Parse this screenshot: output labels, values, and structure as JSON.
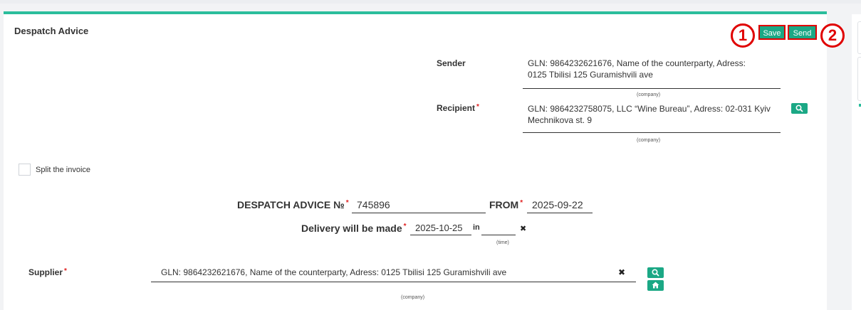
{
  "form": {
    "title": "Despatch Advice",
    "save_label": "Save",
    "send_label": "Send",
    "badge1": "1",
    "badge2": "2"
  },
  "sender": {
    "label": "Sender",
    "value_line1": "GLN: 9864232621676, Name of the counterparty, Adress:",
    "value_line2": "0125 Tbilisi 125 Guramishvili ave",
    "caption": "(company)"
  },
  "recipient": {
    "label": "Recipient",
    "required": "*",
    "value_line1": "GLN: 9864232758075, LLC “Wine Bureau”, Adress: 02-031 Kyiv",
    "value_line2": "Mechnikova st. 9",
    "caption": "(company)",
    "search_icon": "search-icon"
  },
  "split": {
    "label": "Split the invoice",
    "checked": false
  },
  "header": {
    "number_label": "DESPATCH ADVICE №",
    "number_required": "*",
    "number_value": "745896",
    "from_label": "FROM",
    "from_required": "*",
    "from_value": "2025-09-22",
    "delivery_label": "Delivery will be made",
    "delivery_required": "*",
    "delivery_value": "2025-10-25",
    "in_label": "in",
    "time_value": "",
    "time_caption": "(time)",
    "clear_icon": "✖"
  },
  "supplier": {
    "label": "Supplier",
    "required": "*",
    "value": "GLN: 9864232621676, Name of the counterparty, Adress: 0125 Tbilisi 125 Guramishvili ave",
    "caption": "(company)",
    "clear_icon": "✖",
    "search_icon": "search-icon",
    "home_icon": "home-icon"
  },
  "colors": {
    "accent": "#2bbd9c",
    "button": "#1ba885",
    "highlight": "#e00000",
    "required": "#e02020"
  }
}
